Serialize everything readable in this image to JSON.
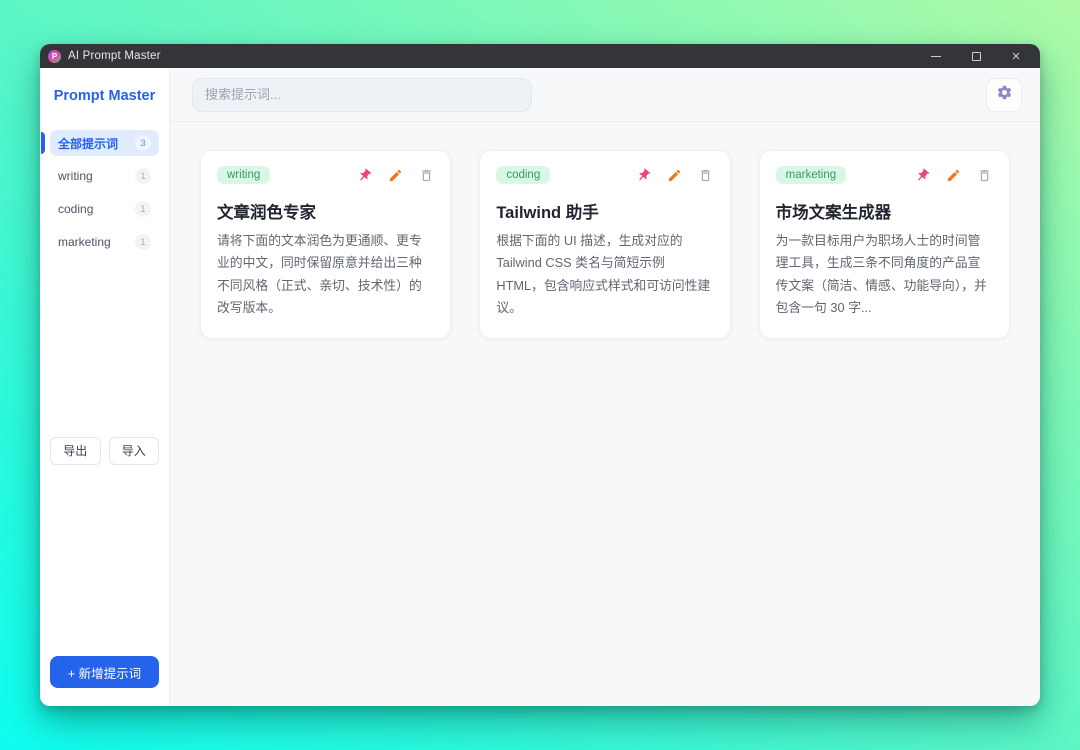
{
  "titlebar": {
    "app_title": "AI Prompt Master",
    "logo_letter": "P",
    "close_glyph": "✕"
  },
  "sidebar": {
    "brand": "Prompt Master",
    "nav": [
      {
        "label": "全部提示词",
        "count": "3",
        "active": true
      },
      {
        "label": "writing",
        "count": "1",
        "active": false
      },
      {
        "label": "coding",
        "count": "1",
        "active": false
      },
      {
        "label": "marketing",
        "count": "1",
        "active": false
      }
    ],
    "export_label": "导出",
    "import_label": "导入",
    "add_label": "+ 新增提示词"
  },
  "header": {
    "search_placeholder": "搜索提示词..."
  },
  "cards": [
    {
      "tag": "writing",
      "title": "文章润色专家",
      "description": "请将下面的文本润色为更通顺、更专业的中文，同时保留原意并给出三种不同风格（正式、亲切、技术性）的改写版本。"
    },
    {
      "tag": "coding",
      "title": "Tailwind 助手",
      "description": "根据下面的 UI 描述，生成对应的 Tailwind CSS 类名与简短示例 HTML，包含响应式样式和可访问性建议。"
    },
    {
      "tag": "marketing",
      "title": "市场文案生成器",
      "description": "为一款目标用户为职场人士的时间管理工具，生成三条不同角度的产品宣传文案（简洁、情感、功能导向），并包含一句 30 字..."
    }
  ],
  "colors": {
    "accent_blue": "#2563eb",
    "tag_green_bg": "#d9f7e6",
    "tag_green_text": "#37966a",
    "pin_pink": "#e8486d",
    "pencil_orange": "#f97316",
    "trash_gray": "#a7adb7",
    "gear_purple": "#8f8bbf",
    "titlebar_bg": "#333538"
  }
}
